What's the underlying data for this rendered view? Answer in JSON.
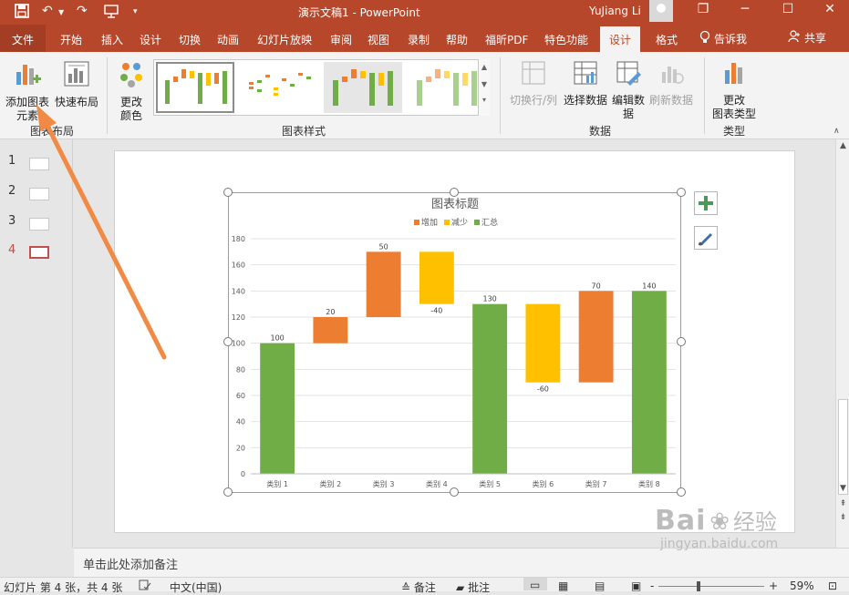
{
  "titlebar": {
    "doc_title": "演示文稿1  -  PowerPoint",
    "user": "YuJiang Li",
    "save_icon": "save-icon",
    "undo_glyph": "↶",
    "redo_glyph": "↷",
    "restore_glyph": "❐",
    "minimize_glyph": "─",
    "maximize_glyph": "☐",
    "close_glyph": "✕"
  },
  "tabs": {
    "file": "文件",
    "home": "开始",
    "insert": "插入",
    "design": "设计",
    "transitions": "切换",
    "animations": "动画",
    "slideshow": "幻灯片放映",
    "review": "审阅",
    "view": "视图",
    "record": "录制",
    "help": "帮助",
    "foxit": "福昕PDF",
    "special": "特色功能",
    "chart_design": "设计",
    "format": "格式",
    "tell_me": "告诉我",
    "share": "共享"
  },
  "ribbon": {
    "add_element": "添加图表\n元素",
    "quick_layout": "快速布局",
    "change_colors": "更改\n颜色",
    "group_layout": "图表布局",
    "group_styles": "图表样式",
    "switch_rowcol": "切换行/列",
    "select_data": "选择数据",
    "edit_data": "编辑数\n据",
    "refresh_data": "刷新数据",
    "group_data": "数据",
    "change_type": "更改\n图表类型",
    "group_type": "类型"
  },
  "slides_panel": {
    "numbers": [
      "1",
      "2",
      "3",
      "4"
    ],
    "active_index": 3
  },
  "chart_data": {
    "type": "bar",
    "subtype": "waterfall",
    "title": "图表标题",
    "legend": [
      "增加",
      "减少",
      "汇总"
    ],
    "legend_position": "top",
    "categories": [
      "类别 1",
      "类别 2",
      "类别 3",
      "类别 4",
      "类别 5",
      "类别 6",
      "类别 7",
      "类别 8"
    ],
    "values": [
      100,
      20,
      50,
      -40,
      130,
      -60,
      70,
      140
    ],
    "data_labels": [
      "100",
      "20",
      "50",
      "-40",
      "130",
      "-60",
      "70",
      "140"
    ],
    "kinds": [
      "total",
      "increase",
      "increase",
      "decrease",
      "total",
      "decrease",
      "increase",
      "total"
    ],
    "ranges": [
      [
        0,
        100
      ],
      [
        100,
        120
      ],
      [
        120,
        170
      ],
      [
        130,
        170
      ],
      [
        0,
        130
      ],
      [
        70,
        130
      ],
      [
        70,
        140
      ],
      [
        0,
        140
      ]
    ],
    "y_ticks": [
      "0",
      "20",
      "40",
      "60",
      "80",
      "100",
      "120",
      "140",
      "160",
      "180"
    ],
    "ylim": [
      0,
      180
    ],
    "colors": {
      "increase": "#ed7d31",
      "decrease": "#ffc000",
      "total": "#70ad47"
    },
    "grid": true
  },
  "notes": {
    "placeholder": "单击此处添加备注"
  },
  "status": {
    "slide_info": "幻灯片 第 4 张，共 4 张",
    "language": "中文(中国)",
    "notes": "备注",
    "comments": "批注",
    "zoom": "59%",
    "zoom_minus": "-",
    "zoom_plus": "+"
  },
  "watermark": {
    "brand": "Bai",
    "brand_cn": "经验",
    "url": "jingyan.baidu.com"
  },
  "annotation": {
    "arrow_color": "#f08a45"
  }
}
